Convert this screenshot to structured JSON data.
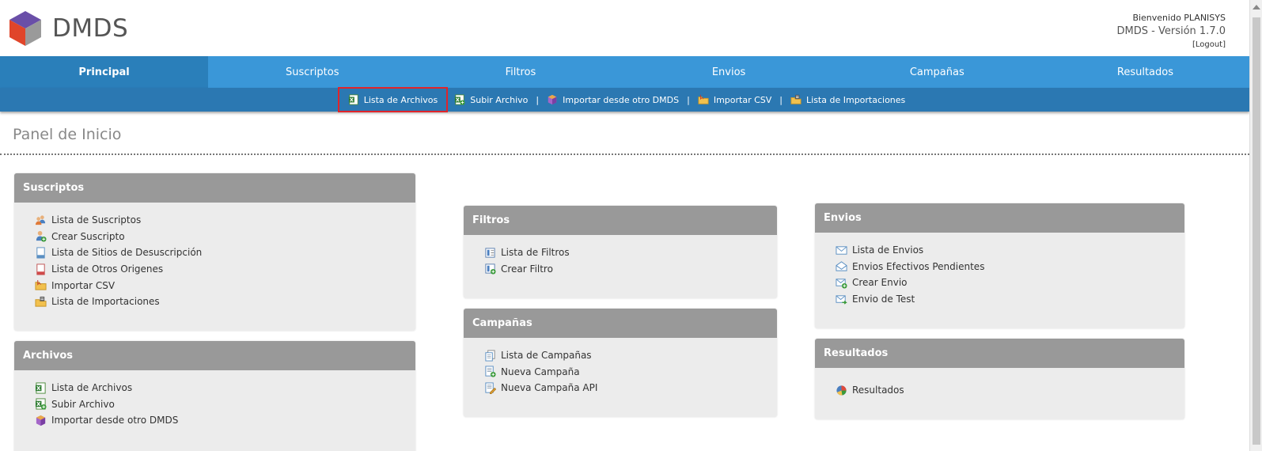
{
  "header": {
    "logo_text": "DMDS",
    "welcome": "Bienvenido PLANISYS",
    "version": "DMDS - Versión 1.7.0",
    "logout": "[Logout]"
  },
  "mainnav": {
    "tabs": [
      {
        "label": "Principal",
        "active": true
      },
      {
        "label": "Suscriptos"
      },
      {
        "label": "Filtros"
      },
      {
        "label": "Envios"
      },
      {
        "label": "Campañas"
      },
      {
        "label": "Resultados"
      }
    ]
  },
  "subnav": {
    "items": [
      {
        "label": "Lista de Archivos",
        "icon": "excel-file-icon",
        "selected": true
      },
      {
        "label": "Subir Archivo",
        "icon": "excel-upload-icon"
      },
      {
        "label": "Importar desde otro DMDS",
        "icon": "package-box-icon"
      },
      {
        "label": "Importar CSV",
        "icon": "folder-import-icon"
      },
      {
        "label": "Lista de Importaciones",
        "icon": "folder-list-icon"
      }
    ],
    "separator": "|"
  },
  "page": {
    "title": "Panel de Inicio"
  },
  "panels": {
    "suscriptos": {
      "title": "Suscriptos",
      "items": [
        {
          "label": "Lista de Suscriptos",
          "icon": "users-icon"
        },
        {
          "label": "Crear Suscripto",
          "icon": "user-add-icon"
        },
        {
          "label": "Lista de Sitios de Desuscripción",
          "icon": "document-icon"
        },
        {
          "label": "Lista de Otros Origenes",
          "icon": "document-red-icon"
        },
        {
          "label": "Importar CSV",
          "icon": "folder-import-icon"
        },
        {
          "label": "Lista de Importaciones",
          "icon": "folder-list-icon"
        }
      ]
    },
    "archivos": {
      "title": "Archivos",
      "items": [
        {
          "label": "Lista de Archivos",
          "icon": "excel-file-icon"
        },
        {
          "label": "Subir Archivo",
          "icon": "excel-upload-icon"
        },
        {
          "label": "Importar desde otro DMDS",
          "icon": "package-box-icon"
        }
      ]
    },
    "filtros": {
      "title": "Filtros",
      "items": [
        {
          "label": "Lista de Filtros",
          "icon": "filter-list-icon"
        },
        {
          "label": "Crear Filtro",
          "icon": "filter-add-icon"
        }
      ]
    },
    "campanas": {
      "title": "Campañas",
      "items": [
        {
          "label": "Lista de Campañas",
          "icon": "pages-icon"
        },
        {
          "label": "Nueva Campaña",
          "icon": "page-add-icon"
        },
        {
          "label": "Nueva Campaña API",
          "icon": "page-edit-icon"
        }
      ]
    },
    "envios": {
      "title": "Envios",
      "items": [
        {
          "label": "Lista de Envios",
          "icon": "mail-icon"
        },
        {
          "label": "Envios Efectivos Pendientes",
          "icon": "mail-open-icon"
        },
        {
          "label": "Crear Envio",
          "icon": "mail-add-icon"
        },
        {
          "label": "Envio de Test",
          "icon": "mail-send-icon"
        }
      ]
    },
    "resultados": {
      "title": "Resultados",
      "items": [
        {
          "label": "Resultados",
          "icon": "pie-chart-icon"
        }
      ]
    }
  },
  "colors": {
    "nav_blue": "#3a97d8",
    "nav_active": "#2a7fba",
    "subnav_blue": "#2b78b2",
    "panel_header": "#999999",
    "panel_body": "#ececec",
    "highlight_red": "#e0242b"
  }
}
